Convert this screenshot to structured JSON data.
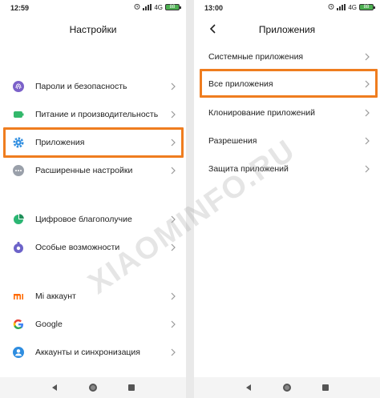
{
  "left": {
    "status": {
      "time": "12:59",
      "network": "4G",
      "battery": "88"
    },
    "title": "Настройки",
    "items": [
      {
        "label": "Пароли и безопасность",
        "icon": "fingerprint-icon"
      },
      {
        "label": "Питание и производительность",
        "icon": "battery-icon"
      },
      {
        "label": "Приложения",
        "icon": "gear-icon"
      },
      {
        "label": "Расширенные настройки",
        "icon": "more-dots-icon"
      },
      {
        "label": "Цифровое благополучие",
        "icon": "wellbeing-icon"
      },
      {
        "label": "Особые возможности",
        "icon": "accessibility-icon"
      },
      {
        "label": "Mi аккаунт",
        "icon": "mi-logo-icon"
      },
      {
        "label": "Google",
        "icon": "google-icon"
      },
      {
        "label": "Аккаунты и синхронизация",
        "icon": "person-icon"
      }
    ]
  },
  "right": {
    "status": {
      "time": "13:00",
      "network": "4G",
      "battery": "88"
    },
    "title": "Приложения",
    "items": [
      {
        "label": "Системные приложения"
      },
      {
        "label": "Все приложения"
      },
      {
        "label": "Клонирование приложений"
      },
      {
        "label": "Разрешения"
      },
      {
        "label": "Защита приложений"
      }
    ]
  },
  "watermark": "XIAOMINFO.RU",
  "colors": {
    "highlight": "#ef7d1f",
    "accent_blue": "#2e8de0",
    "wellbeing_green": "#2bb673",
    "access_purple": "#6c63c9",
    "mi_orange": "#ff6900"
  }
}
